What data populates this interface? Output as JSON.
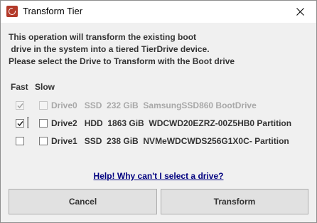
{
  "window": {
    "title": "Transform Tier"
  },
  "message": {
    "lines": [
      "This operation will transform the existing boot",
      " drive in the system into a tiered TierDrive device.",
      "Please select the Drive to Transform with the Boot drive"
    ]
  },
  "columns": {
    "fast": "Fast",
    "slow": "Slow"
  },
  "drives": [
    {
      "label": "Drive0   SSD  232 GiB  SamsungSSD860 BootDrive",
      "fast_checked": true,
      "slow_checked": false,
      "disabled": true
    },
    {
      "label": "Drive2   HDD  1863 GiB  WDCWD20EZRZ-00Z5HB0 Partition",
      "fast_checked": true,
      "slow_checked": false,
      "disabled": false
    },
    {
      "label": "Drive1   SSD  238 GiB  NVMeWDCWDS256G1X0C- Partition",
      "fast_checked": false,
      "slow_checked": false,
      "disabled": false
    }
  ],
  "help_link": "Help! Why can't I select a drive?",
  "buttons": {
    "cancel": "Cancel",
    "transform": "Transform"
  }
}
